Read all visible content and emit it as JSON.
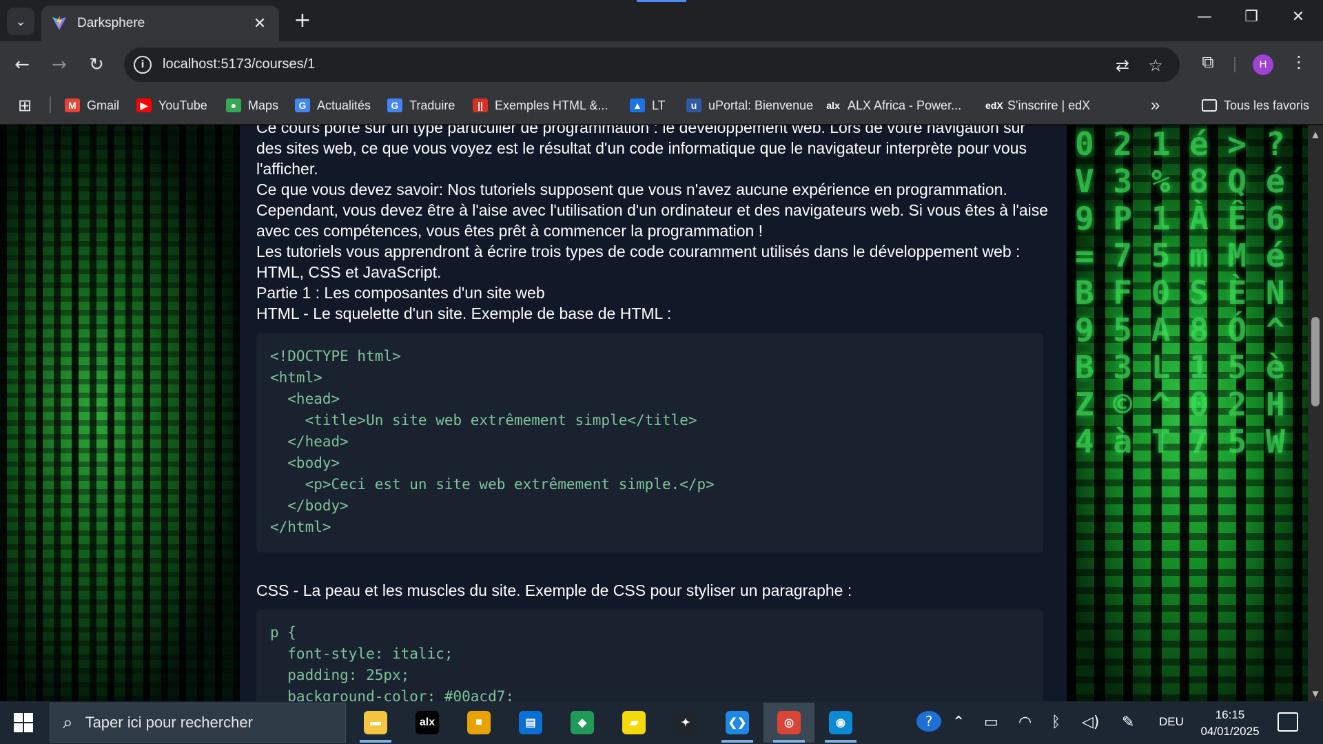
{
  "browser": {
    "tab_title": "Darksphere",
    "tab_close": "✕",
    "new_tab": "+",
    "window_controls": {
      "minimize": "—",
      "restore": "❐",
      "close": "✕"
    },
    "url": "localhost:5173/courses/1",
    "profile_initial": "H",
    "bookmarks": [
      {
        "label": "Gmail",
        "icon": "gmail-icon",
        "icon_text": "M",
        "color": "#ea4335"
      },
      {
        "label": "YouTube",
        "icon": "youtube-icon",
        "icon_text": "▶",
        "color": "#ff0000"
      },
      {
        "label": "Maps",
        "icon": "maps-icon",
        "icon_text": "●",
        "color": "#34a853"
      },
      {
        "label": "Actualités",
        "icon": "news-icon",
        "icon_text": "G",
        "color": "#4285f4"
      },
      {
        "label": "Traduire",
        "icon": "translate-icon",
        "icon_text": "G",
        "color": "#4285f4"
      },
      {
        "label": "Exemples HTML &...",
        "icon": "w3-icon",
        "icon_text": "||",
        "color": "#d93025"
      },
      {
        "label": "LT",
        "icon": "lt-icon",
        "icon_text": "▲",
        "color": "#1a73e8"
      },
      {
        "label": "uPortal: Bienvenue",
        "icon": "uportal-icon",
        "icon_text": "u",
        "color": "#2e5aa8"
      },
      {
        "label": "ALX Africa - Power...",
        "icon": "alx-icon",
        "icon_text": "alx",
        "color": "#35363a"
      },
      {
        "label": "S'inscrire | edX",
        "icon": "edx-icon",
        "icon_text": "edX",
        "color": "#35363a"
      }
    ],
    "bookmarks_more": "»",
    "all_bookmarks": "Tous les favoris"
  },
  "page": {
    "paragraphs": [
      "Ce cours porte sur un type particulier de programmation : le développement web. Lors de votre navigation sur des sites web, ce que vous voyez est le résultat d'un code informatique que le navigateur interprète pour vous l'afficher.",
      "Ce que vous devez savoir: Nos tutoriels supposent que vous n'avez aucune expérience en programmation. Cependant, vous devez être à l'aise avec l'utilisation d'un ordinateur et des navigateurs web. Si vous êtes à l'aise avec ces compétences, vous êtes prêt à commencer la programmation !",
      "Les tutoriels vous apprendront à écrire trois types de code couramment utilisés dans le développement web : HTML, CSS et JavaScript.",
      "Partie 1 : Les composantes d'un site web",
      "HTML - Le squelette d'un site. Exemple de base de HTML :"
    ],
    "html_code": "<!DOCTYPE html>\n<html>\n  <head>\n    <title>Un site web extrêmement simple</title>\n  </head>\n  <body>\n    <p>Ceci est un site web extrêmement simple.</p>\n  </body>\n</html>",
    "css_title": "CSS - La peau et les muscles du site. Exemple de CSS pour styliser un paragraphe :",
    "css_code": "p {\n  font-style: italic;\n  padding: 25px;\n  background-color: #00acd7;\n  ...",
    "matrix_glyphs": "0 2 1 é > ? V 3 % 8 Q é 9 P 1 À Ê 6 = 7 5 m M é B F 0 S È N 9 5 A 8 Ó ^ B 3 L 1 5 è Z © ^ 0 2 H 4 à T 7 5 W"
  },
  "taskbar": {
    "search_placeholder": "Taper ici pour rechercher",
    "apps": [
      {
        "name": "file-explorer",
        "icon_text": "▬",
        "color": "#f5c542"
      },
      {
        "name": "alx-app",
        "icon_text": "alx",
        "color": "#000000"
      },
      {
        "name": "microsoft-store",
        "icon_text": "■",
        "color": "#e8a202"
      },
      {
        "name": "news-app",
        "icon_text": "▤",
        "color": "#0a6fd6"
      },
      {
        "name": "git-app",
        "icon_text": "◆",
        "color": "#1f9a58"
      },
      {
        "name": "sticky-notes",
        "icon_text": "▰",
        "color": "#f5d90a"
      },
      {
        "name": "dev-app",
        "icon_text": "✦",
        "color": "#20252b"
      },
      {
        "name": "vscode",
        "icon_text": "❮❯",
        "color": "#1e88e5"
      },
      {
        "name": "chrome",
        "icon_text": "◎",
        "color": "#db4437"
      },
      {
        "name": "edge",
        "icon_text": "◉",
        "color": "#0c8ad6"
      }
    ],
    "language": "DEU",
    "time": "16:15",
    "date": "04/01/2025"
  }
}
